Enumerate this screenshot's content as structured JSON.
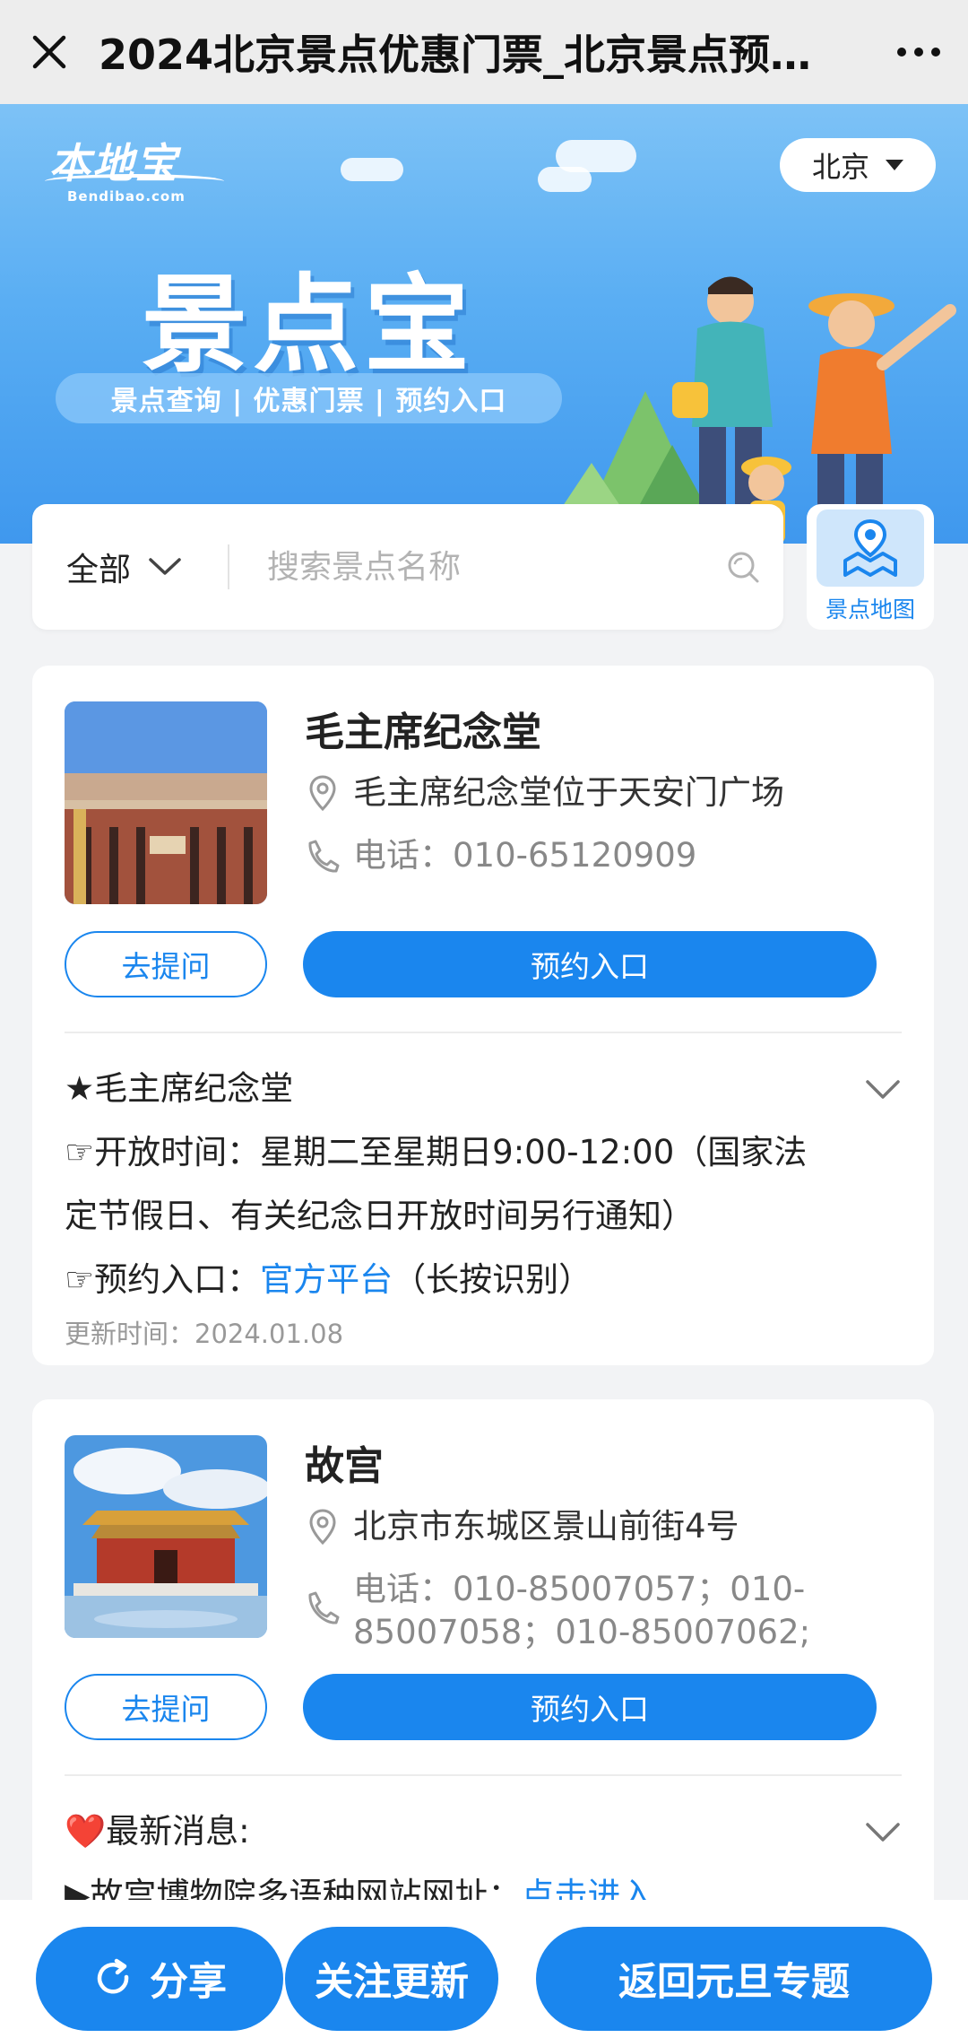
{
  "topbar": {
    "title": "2024北京景点优惠门票_北京景点预约入口"
  },
  "banner": {
    "logo_cn": "本地宝",
    "logo_en": "Bendibao.com",
    "city": "北京",
    "big_title": "景点宝",
    "subtitle": "景点查询 | 优惠门票 | 预约入口"
  },
  "search": {
    "filter_label": "全部",
    "placeholder": "搜索景点名称",
    "map_label": "景点地图"
  },
  "cards": [
    {
      "name": "毛主席纪念堂",
      "address": "毛主席纪念堂位于天安门广场",
      "phone": "电话：010-65120909",
      "ask_label": "去提问",
      "book_label": "预约入口",
      "info_title": "★毛主席纪念堂",
      "open_prefix": "☞开放时间：",
      "open_line1": "星期二至星期日9:00-12:00（国家法",
      "open_line2": "定节假日、有关纪念日开放时间另行通知）",
      "booking_prefix": "☞预约入口：",
      "booking_link": "官方平台",
      "booking_suffix": "（长按识别）",
      "updated": "更新时间：2024.01.08"
    },
    {
      "name": "故宫",
      "address": "北京市东城区景山前街4号",
      "phone_line1": "电话：010-85007057；010-",
      "phone_line2": "85007058；010-85007062;",
      "ask_label": "去提问",
      "book_label": "预约入口",
      "news_title": "❤️最新消息:",
      "news_item": "▶故宫博物院多语种网站网址：",
      "news_link": "点击进入"
    }
  ],
  "bottom": {
    "share_label": "分享",
    "follow_label": "关注更新",
    "back_label": "返回元旦专题"
  },
  "colors": {
    "accent": "#1a86ee",
    "banner": "#5aaef3"
  }
}
